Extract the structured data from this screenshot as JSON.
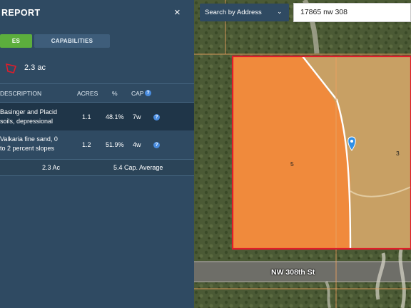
{
  "panel": {
    "title": "REPORT",
    "close_label": "×",
    "tabs": [
      {
        "label": "ES"
      },
      {
        "label": "CAPABILITIES"
      }
    ],
    "acreage": "2.3 ac",
    "columns": {
      "description": "DESCRIPTION",
      "acres": "ACRES",
      "pct": "%",
      "cap": "CAP"
    },
    "rows": [
      {
        "desc1": "Basinger and Placid",
        "desc2": "soils, depressional",
        "acres": "1.1",
        "pct": "48.1%",
        "cap": "7w"
      },
      {
        "desc1": "Valkaria fine sand, 0",
        "desc2": "to 2 percent slopes",
        "acres": "1.2",
        "pct": "51.9%",
        "cap": "4w"
      }
    ],
    "footer": {
      "total": "2.3 Ac",
      "average": "5.4 Cap. Average"
    },
    "help_glyph": "?"
  },
  "search": {
    "mode_label": "Search by Address",
    "chevron": "⌄",
    "address_value": "17865 nw 308"
  },
  "map": {
    "road_label": "NW 308th St",
    "parcel_labels": [
      "5",
      "3"
    ]
  },
  "colors": {
    "accent_green": "#5cae3d",
    "panel_bg": "#2f4a62",
    "parcel_border": "#e11d2a",
    "soil_orange": "#f08a3c",
    "soil_tan": "#c8a064"
  }
}
